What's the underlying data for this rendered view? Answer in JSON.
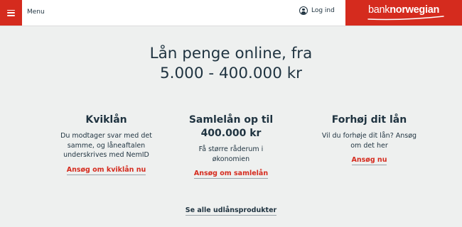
{
  "header": {
    "menu_label": "Menu",
    "login_label": "Log ind",
    "logo": {
      "part1": "bank",
      "part2": "norwegian"
    },
    "accent_color": "#d52b1e"
  },
  "hero": {
    "line1": "Lån penge online, fra",
    "line2": "5.000 - 400.000 kr"
  },
  "products": [
    {
      "title": "Kviklån",
      "description": [
        "Du modtager svar med det",
        "samme, og låneaftalen",
        "underskrives med NemID"
      ],
      "link": "Ansøg om kviklån nu"
    },
    {
      "title": [
        "Samlelån op til",
        "400.000 kr"
      ],
      "description": [
        "Få større råderum i",
        "økonomien"
      ],
      "link": "Ansøg om samlelån"
    },
    {
      "title": "Forhøj dit lån",
      "description": [
        "Vil du forhøje dit lån? Ansøg",
        "om det her"
      ],
      "link": "Ansøg nu"
    }
  ],
  "all_products_link": "Se alle udlånsprodukter"
}
